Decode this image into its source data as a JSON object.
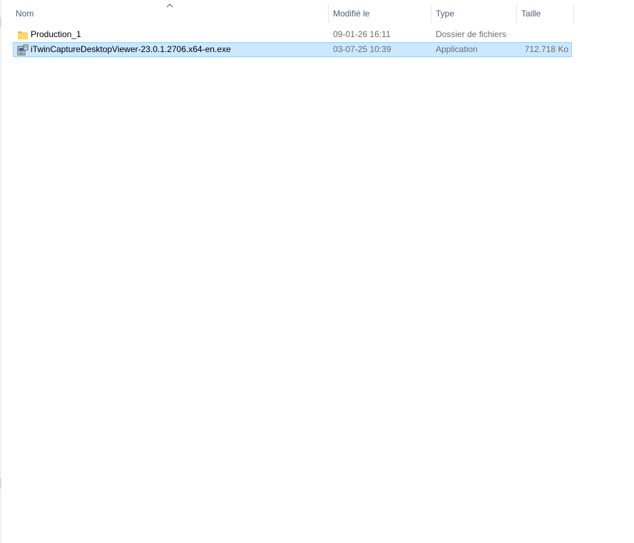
{
  "columns": {
    "name": "Nom",
    "modified": "Modifié le",
    "type": "Type",
    "size": "Taille"
  },
  "sort_icon": "chevron-up-icon",
  "files": [
    {
      "icon": "folder-icon",
      "name": "Production_1",
      "modified": "09-01-26 16:11",
      "type": "Dossier de fichiers",
      "size": "",
      "selected": false
    },
    {
      "icon": "application-installer-icon",
      "name": "iTwinCaptureDesktopViewer-23.0.1.2706.x64-en.exe",
      "modified": "03-07-25 10:39",
      "type": "Application",
      "size": "712.718 Ko",
      "selected": true
    }
  ],
  "colors": {
    "header_text": "#4c607a",
    "selection_bg": "#cce8ff",
    "selection_border": "#99d1ff",
    "folder_yellow": "#ffd766"
  }
}
